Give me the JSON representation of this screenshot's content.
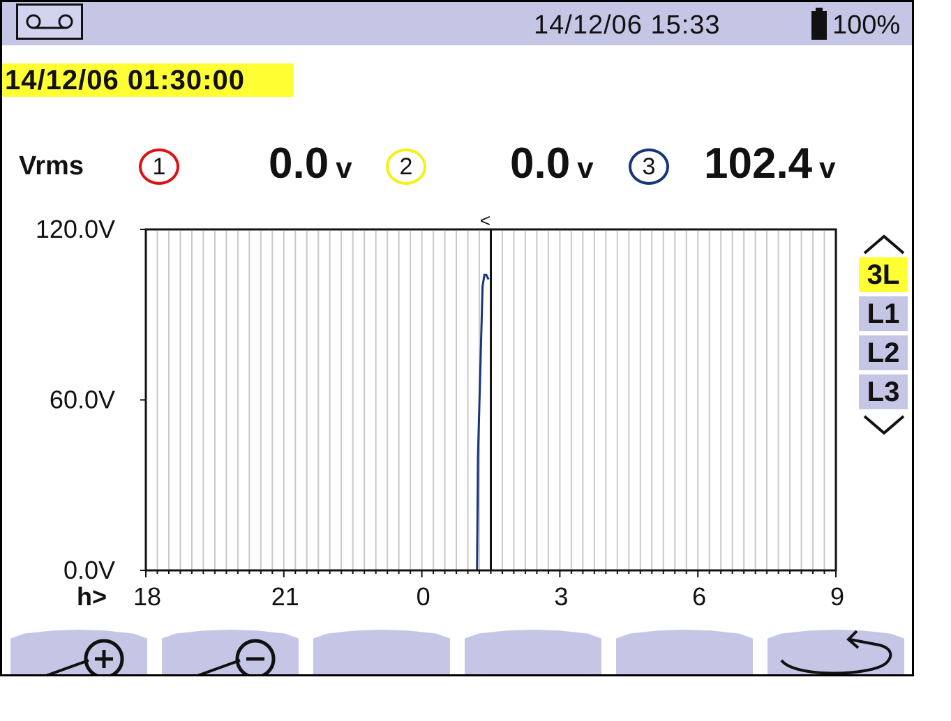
{
  "status": {
    "datetime": "14/12/06 15:33",
    "battery": "100%",
    "record_icon": "tape-record-icon",
    "battery_icon": "battery-icon"
  },
  "cursor_timestamp": "14/12/06  01:30:00",
  "readings": {
    "label": "Vrms",
    "phases": [
      {
        "number": "1",
        "value": "0.0",
        "unit": "v",
        "color": "#e01010"
      },
      {
        "number": "2",
        "value": "0.0",
        "unit": "v",
        "color": "#f4f018"
      },
      {
        "number": "3",
        "value": "102.4",
        "unit": "v",
        "color": "#15367a"
      }
    ]
  },
  "phase_selector": {
    "up_icon": "chevron-up-icon",
    "down_icon": "chevron-down-icon",
    "items": [
      {
        "label": "3L",
        "active": true
      },
      {
        "label": "L1",
        "active": false
      },
      {
        "label": "L2",
        "active": false
      },
      {
        "label": "L3",
        "active": false
      }
    ]
  },
  "softkeys": [
    {
      "icon": "zoom-in-icon"
    },
    {
      "icon": "zoom-out-icon"
    },
    {
      "icon": ""
    },
    {
      "icon": ""
    },
    {
      "icon": ""
    },
    {
      "icon": "return-icon"
    }
  ],
  "chart_data": {
    "type": "line",
    "title": "",
    "xlabel": "h>",
    "ylabel": "",
    "ylim": [
      0,
      120
    ],
    "xlim": [
      18,
      33
    ],
    "x_tick_values": [
      18,
      21,
      24,
      27,
      30,
      33
    ],
    "x_tick_labels": [
      "18",
      "21",
      "0",
      "3",
      "6",
      "9"
    ],
    "y_tick_values": [
      0,
      60,
      120
    ],
    "y_tick_labels": [
      "0.0V",
      "60.0V",
      "120.0V"
    ],
    "cursor_x": 25.5,
    "cursor_marker": "<",
    "grid": true,
    "series": [
      {
        "color": "#e01010",
        "x": [
          19.25,
          25.25
        ],
        "y": [
          0,
          0
        ]
      },
      {
        "color": "#f4f018",
        "x": [
          25.25,
          25.5
        ],
        "y": [
          0,
          0
        ]
      },
      {
        "color": "#15367a",
        "x": [
          19.25,
          25.2,
          25.22,
          25.28,
          25.32,
          25.36,
          25.4,
          25.45
        ],
        "y": [
          0,
          0,
          40,
          76,
          100,
          104,
          104,
          102.4
        ]
      }
    ]
  }
}
